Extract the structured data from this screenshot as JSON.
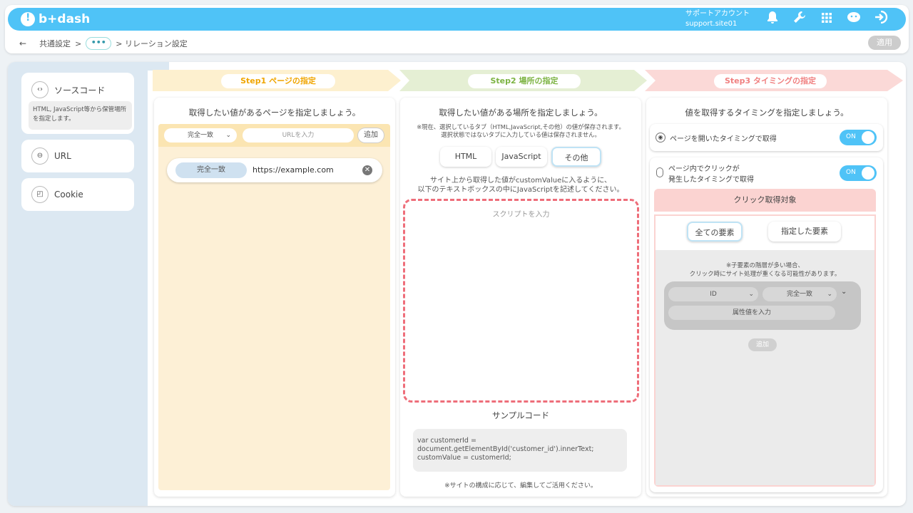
{
  "header": {
    "logo": "b+dash",
    "account_name": "サポートアカウント",
    "account_id": "support.site01",
    "icons": [
      "bell-icon",
      "wrench-icon",
      "grid-icon",
      "mascot-icon",
      "logout-icon"
    ]
  },
  "breadcrumb": {
    "back": "←",
    "item1": "共通設定",
    "sep": ">",
    "dots": "•••",
    "item3": "> リレーション設定"
  },
  "apply_label": "適用",
  "sidebar": {
    "items": [
      {
        "label": "ソースコード",
        "icon": "‹›",
        "desc": "HTML, JavaScript等から保管場所を指定します。"
      },
      {
        "label": "URL",
        "icon": "⊖"
      },
      {
        "label": "Cookie",
        "icon": "◰"
      }
    ]
  },
  "steps": [
    {
      "label": "Step1 ページの指定",
      "color": "#f0b429"
    },
    {
      "label": "Step2 場所の指定",
      "color": "#8bc34a"
    },
    {
      "label": "Step3 タイミングの指定",
      "color": "#f48a8a"
    }
  ],
  "step1": {
    "title": "取得したい値があるページを指定しましょう。",
    "match_select": "完全一致",
    "url_placeholder": "URLを入力",
    "add_label": "追加",
    "row_match": "完全一致",
    "row_url": "https://example.com"
  },
  "step2": {
    "title": "取得したい値がある場所を指定しましょう。",
    "note1": "※現在、選択しているタブ（HTML,JavaScript,その他）の値が保存されます。",
    "note2": "選択状態ではないタブに入力している値は保存されません。",
    "tabs": [
      "HTML",
      "JavaScript",
      "その他"
    ],
    "instr1": "サイト上から取得した値がcustomValueに入るように、",
    "instr2": "以下のテキストボックスの中にJavaScriptを記述してください。",
    "script_placeholder": "スクリプトを入力",
    "sample_title": "サンプルコード",
    "sample_line1": "var customerId =",
    "sample_line2": "document.getElementById('customer_id').innerText;",
    "sample_line3": "customValue = customerId;",
    "footer_note": "※サイトの構成に応じて、編集してご活用ください。"
  },
  "step3": {
    "title": "値を取得するタイミングを指定しましょう。",
    "opt1": "ページを開いたタイミングで取得",
    "opt2_line1": "ページ内でクリックが",
    "opt2_line2": "発生したタイミングで取得",
    "toggle_on": "ON",
    "click_target": "クリック取得対象",
    "tab_all": "全ての要素",
    "tab_specified": "指定した要素",
    "warn1": "※子要素の階層が多い場合、",
    "warn2": "クリック時にサイト処理が重くなる可能性があります。",
    "attr_select": "ID",
    "match_select": "完全一致",
    "attr_placeholder": "属性値を入力",
    "add_label": "追加"
  }
}
